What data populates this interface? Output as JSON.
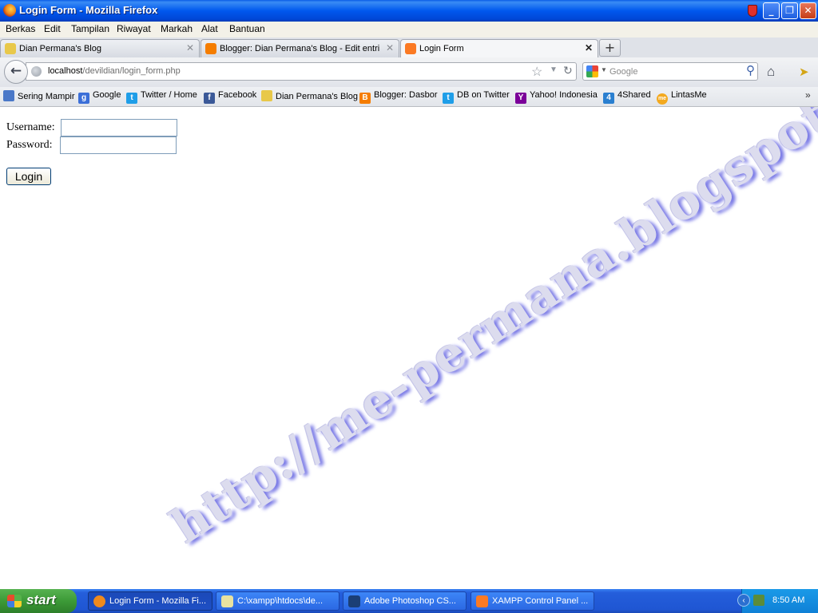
{
  "window": {
    "title": "Login Form - Mozilla Firefox",
    "controls": {
      "minimize": "_",
      "maximize": "❐",
      "close": "✕"
    }
  },
  "menu": [
    "Berkas",
    "Edit",
    "Tampilan",
    "Riwayat",
    "Markah",
    "Alat",
    "Bantuan"
  ],
  "tabs": [
    {
      "label": "Dian Permana's Blog",
      "icon": "pencil-icon",
      "color": "#e8c84a"
    },
    {
      "label": "Blogger: Dian Permana's Blog - Edit entri",
      "icon": "blogger-icon",
      "color": "#f57d00"
    },
    {
      "label": "Login Form",
      "icon": "xampp-icon",
      "color": "#fb7a24",
      "active": true
    }
  ],
  "tab_close": "✕",
  "new_tab": "+",
  "nav": {
    "back": "←",
    "url_host": "localhost",
    "url_path": "/devildian/login_form.php",
    "star": "☆",
    "dropdown": "▼",
    "reload": "↻",
    "search_placeholder": "Google",
    "search_icon": "⚲",
    "home": "⌂",
    "cursor": "➤"
  },
  "bookmarks": [
    {
      "label": "Sering Mampir",
      "icon": "rss-icon",
      "color": "#4a78c8",
      "glyph": ""
    },
    {
      "label": "Google",
      "icon": "google-icon",
      "color": "#3b6fd8",
      "glyph": "g"
    },
    {
      "label": "Twitter / Home",
      "icon": "twitter-icon",
      "color": "#1f9ee8",
      "glyph": "t"
    },
    {
      "label": "Facebook",
      "icon": "facebook-icon",
      "color": "#3b5998",
      "glyph": "f"
    },
    {
      "label": "Dian Permana's Blog",
      "icon": "pencil-icon",
      "color": "#e8c84a",
      "glyph": ""
    },
    {
      "label": "Blogger: Dasbor",
      "icon": "blogger-icon",
      "color": "#f57d00",
      "glyph": "B"
    },
    {
      "label": "DB on Twitter",
      "icon": "twitter-icon",
      "color": "#1f9ee8",
      "glyph": "t"
    },
    {
      "label": "Yahoo! Indonesia",
      "icon": "yahoo-icon",
      "color": "#7b0099",
      "glyph": "Y"
    },
    {
      "label": "4Shared",
      "icon": "4shared-icon",
      "color": "#2a7fd0",
      "glyph": "4"
    },
    {
      "label": "LintasMe",
      "icon": "lintasme-icon",
      "color": "#f3a91f",
      "glyph": "me"
    }
  ],
  "bookmarks_more": "»",
  "form": {
    "username_label": "Username:",
    "username_value": "",
    "password_label": "Password:",
    "password_value": "",
    "submit_label": "Login"
  },
  "watermark": "http://me-permana.blogspot.com",
  "taskbar": {
    "start": "start",
    "tasks": [
      {
        "label": "Login Form - Mozilla Fi...",
        "icon": "firefox-icon",
        "color": "#f08a1d",
        "active": true
      },
      {
        "label": "C:\\xampp\\htdocs\\de...",
        "icon": "notepad-icon",
        "color": "#e8e2a0"
      },
      {
        "label": "Adobe Photoshop CS...",
        "icon": "photoshop-icon",
        "color": "#1b3f76"
      },
      {
        "label": "XAMPP Control Panel ...",
        "icon": "xampp-icon",
        "color": "#fb7a24"
      }
    ],
    "tray_arrow": "‹",
    "clock": "8:50 AM"
  }
}
